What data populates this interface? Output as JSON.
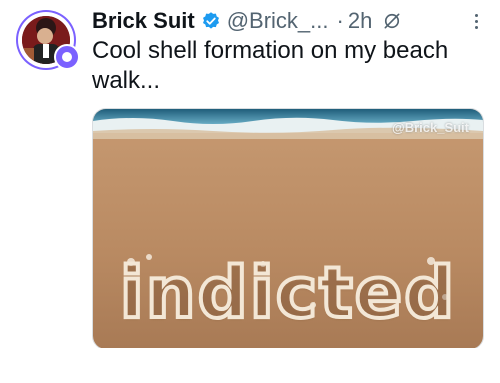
{
  "post": {
    "display_name": "Brick Suit",
    "handle": "@Brick_...",
    "separator": "·",
    "time": "2h",
    "text": "Cool shell formation on my beach walk...",
    "icons": {
      "verified": "verified-badge-icon",
      "grok": "grok-icon",
      "more": "more-options-icon"
    }
  },
  "media": {
    "watermark": "@Brick_Suit",
    "shell_word": "indicted"
  },
  "colors": {
    "accent": "#1d9bf0",
    "badge": "#7b61ff",
    "secondary_text": "#536471"
  }
}
